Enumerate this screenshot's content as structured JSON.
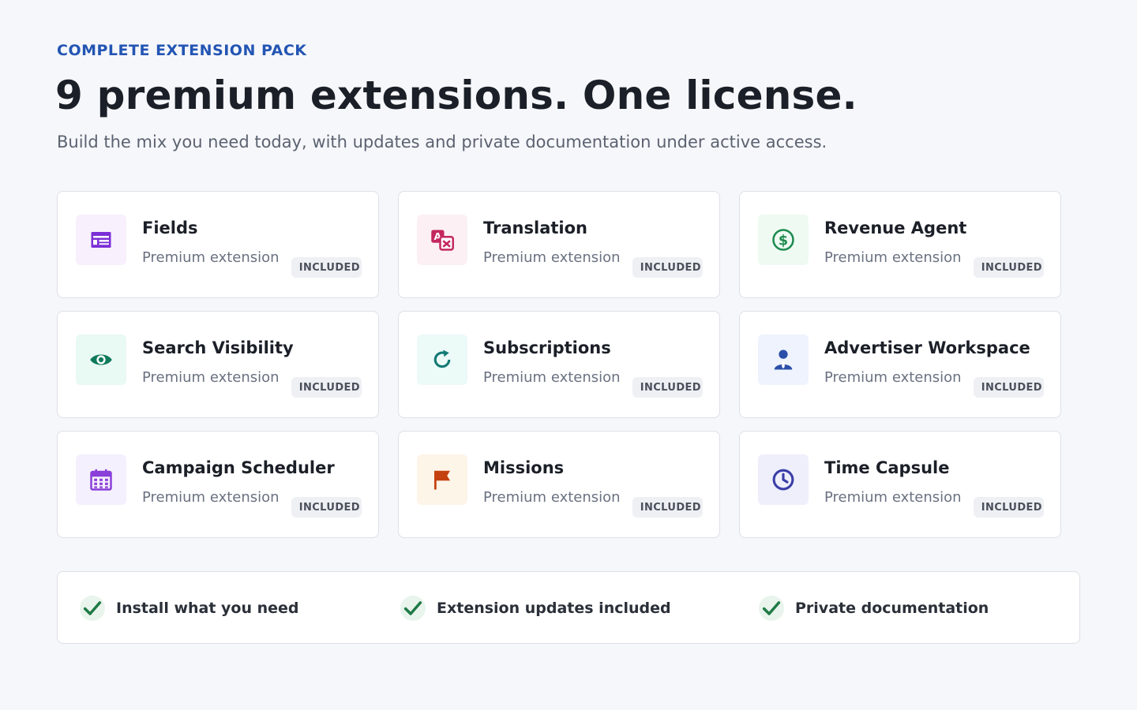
{
  "header": {
    "eyebrow": "COMPLETE EXTENSION PACK",
    "title": "9 premium extensions. One license.",
    "subtitle": "Build the mix you need today, with updates and private documentation under active access."
  },
  "extensions": [
    {
      "name": "Fields",
      "subtitle": "Premium extension",
      "badge": "INCLUDED",
      "icon": "form-fields-icon",
      "color": "#7b2fd6",
      "bg": "#f8f0fc"
    },
    {
      "name": "Translation",
      "subtitle": "Premium extension",
      "badge": "INCLUDED",
      "icon": "translate-icon",
      "color": "#c4275e",
      "bg": "#fcf0f4"
    },
    {
      "name": "Revenue Agent",
      "subtitle": "Premium extension",
      "badge": "INCLUDED",
      "icon": "dollar-circle-icon",
      "color": "#1d8a4e",
      "bg": "#eefaf2"
    },
    {
      "name": "Search Visibility",
      "subtitle": "Premium extension",
      "badge": "INCLUDED",
      "icon": "eye-icon",
      "color": "#0f7a5a",
      "bg": "#e9f9f3"
    },
    {
      "name": "Subscriptions",
      "subtitle": "Premium extension",
      "badge": "INCLUDED",
      "icon": "refresh-icon",
      "color": "#137a74",
      "bg": "#ecfaf8"
    },
    {
      "name": "Advertiser Workspace",
      "subtitle": "Premium extension",
      "badge": "INCLUDED",
      "icon": "user-tie-icon",
      "color": "#2b4fa8",
      "bg": "#eef3fd"
    },
    {
      "name": "Campaign Scheduler",
      "subtitle": "Premium extension",
      "badge": "INCLUDED",
      "icon": "calendar-icon",
      "color": "#8a3fd8",
      "bg": "#f5f0fd"
    },
    {
      "name": "Missions",
      "subtitle": "Premium extension",
      "badge": "INCLUDED",
      "icon": "flag-icon",
      "color": "#c4420f",
      "bg": "#fdf5e8"
    },
    {
      "name": "Time Capsule",
      "subtitle": "Premium extension",
      "badge": "INCLUDED",
      "icon": "clock-icon",
      "color": "#3b3fa8",
      "bg": "#efeffc"
    }
  ],
  "features": [
    {
      "label": "Install what you need",
      "icon": "check-icon"
    },
    {
      "label": "Extension updates included",
      "icon": "check-icon"
    },
    {
      "label": "Private documentation",
      "icon": "check-icon"
    }
  ],
  "colors": {
    "accent": "#2355b3",
    "check": "#1f7a45",
    "check_bg": "#e8f4ec"
  }
}
